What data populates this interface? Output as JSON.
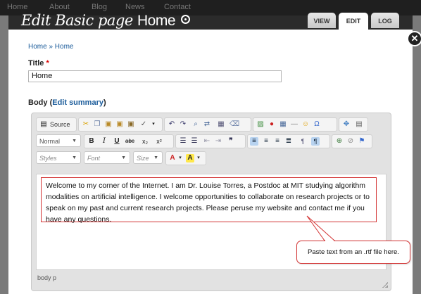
{
  "background_nav": [
    "Home",
    "About",
    "Blog",
    "News",
    "Contact"
  ],
  "overlay": {
    "title_prefix": "Edit Basic page",
    "title_name": "Home",
    "tabs": [
      {
        "label": "VIEW",
        "active": false
      },
      {
        "label": "EDIT",
        "active": true
      },
      {
        "label": "LOG",
        "active": false
      }
    ],
    "close_glyph": "✕"
  },
  "breadcrumb": "Home » Home",
  "title_field": {
    "label": "Title",
    "required_mark": "*",
    "value": "Home"
  },
  "body_field": {
    "label": "Body",
    "summary_link_open": "(",
    "summary_link": "Edit summary",
    "summary_link_close": ")"
  },
  "toolbar": {
    "source_label": "Source",
    "format_value": "Normal",
    "styles_value": "Styles",
    "font_value": "Font",
    "size_value": "Size"
  },
  "editor": {
    "content": "Welcome to my corner of the Internet. I am Dr. Louise Torres, a Postdoc at MIT studying algorithm modalities on artificial intelligence. I welcome opportunities to collaborate on research projects or to speak on my past and current research projects. Please peruse my website and contact me if you have any questions.",
    "status_path": "body  p"
  },
  "callout": "Paste text from an .rtf file here.",
  "colors": {
    "accent_link": "#1a5b9a",
    "highlight_border": "#d33333",
    "required": "#dd0000"
  }
}
